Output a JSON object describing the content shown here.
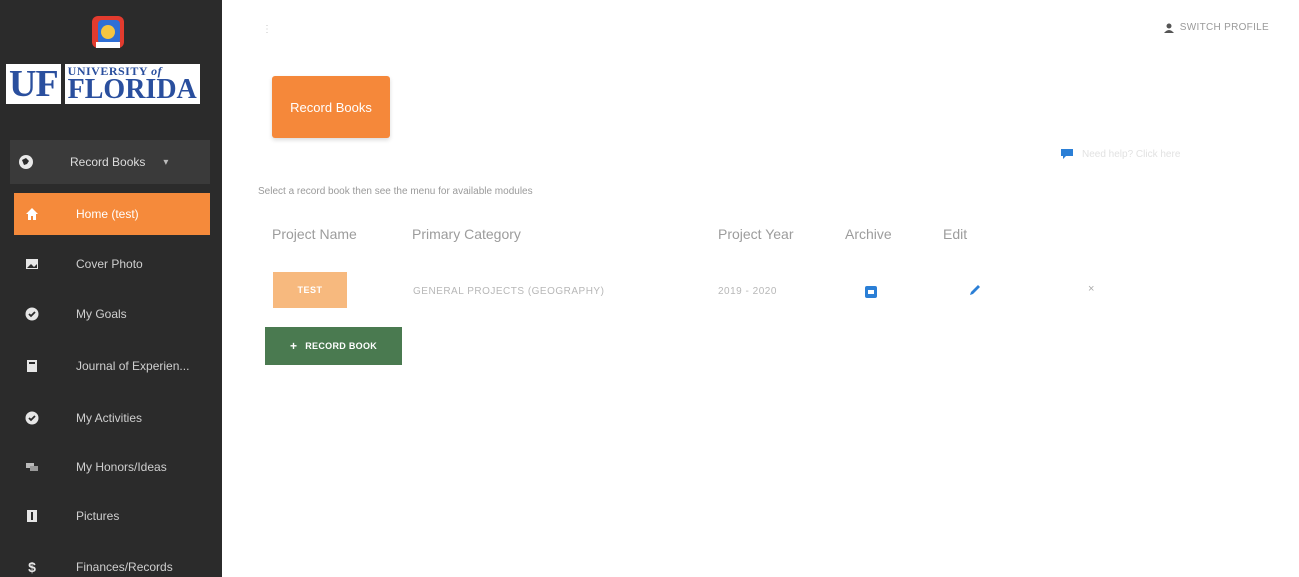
{
  "logo": {
    "text": "UNIVERSITY of FLORIDA",
    "letters": "UF",
    "univ": "UNIVERSITY",
    "of": "of",
    "florida": "FLORIDA"
  },
  "sidebar": {
    "parent": {
      "label": "Record Books",
      "icon": "globe-icon"
    },
    "items": [
      {
        "label": "Home (test)",
        "icon": "home-icon",
        "active": true
      },
      {
        "label": "Cover Photo",
        "icon": "image-icon"
      },
      {
        "label": "My Goals",
        "icon": "check-circle-icon"
      },
      {
        "label": "Journal of Experien...",
        "icon": "book-icon"
      },
      {
        "label": "My Activities",
        "icon": "check-circle-icon"
      },
      {
        "label": "My Honors/Ideas",
        "icon": "chat-icon"
      },
      {
        "label": "Pictures",
        "icon": "camera-icon"
      },
      {
        "label": "Finances/Records",
        "icon": "dollar-icon"
      }
    ]
  },
  "header": {
    "switch_profile": "SWITCH PROFILE"
  },
  "title_card": {
    "label": "Record Books"
  },
  "help": {
    "label": "Need help? Click here"
  },
  "instructions": "Select a record book then see the menu for available modules",
  "table": {
    "headers": [
      "Project Name",
      "Primary Category",
      "Project Year",
      "Archive",
      "Edit"
    ],
    "rows": [
      {
        "project": "TEST",
        "category": "GENERAL PROJECTS (GEOGRAPHY)",
        "year": "2019 - 2020"
      }
    ]
  },
  "add_button": {
    "plus": "+",
    "label": "RECORD BOOK"
  },
  "colors": {
    "accent": "#f58a3b",
    "sidebar": "#2b2b2b",
    "add": "#4a7a50",
    "icon_blue": "#2b7fd6"
  }
}
